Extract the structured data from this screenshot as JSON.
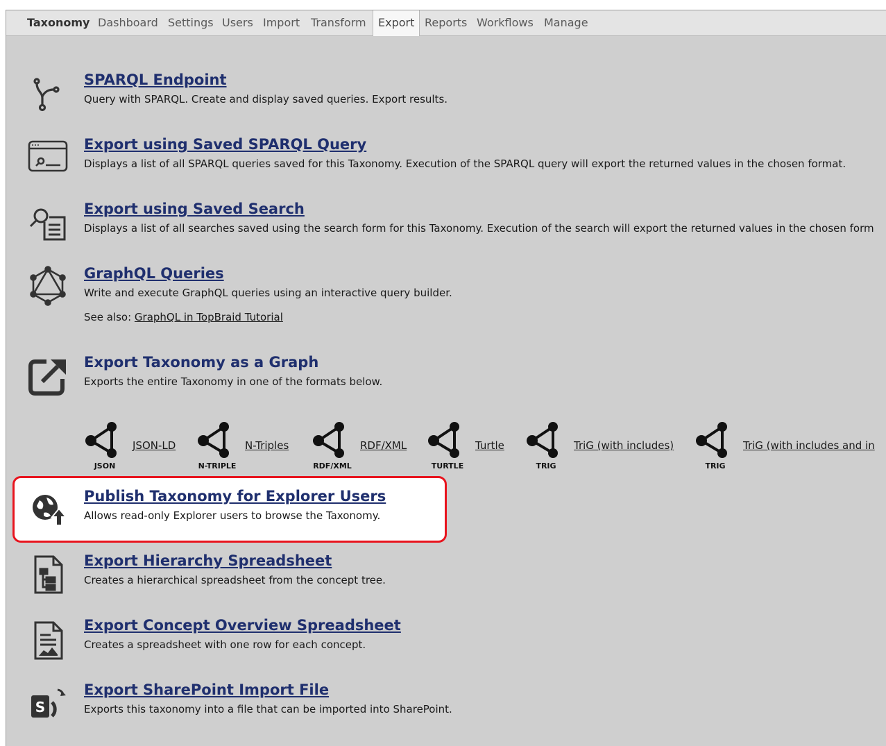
{
  "tabs": [
    "Taxonomy",
    "Dashboard",
    "Settings",
    "Users",
    "Import",
    "Transform",
    "Export",
    "Reports",
    "Workflows",
    "Manage"
  ],
  "active_tab": "Export",
  "items": [
    {
      "icon": "sparql-branch-icon",
      "title": "SPARQL Endpoint",
      "desc": "Query with SPARQL. Create and display saved queries. Export results."
    },
    {
      "icon": "saved-query-window-icon",
      "title": "Export using Saved SPARQL Query",
      "desc": "Displays a list of all SPARQL queries saved for this Taxonomy. Execution of the SPARQL query will export the returned values in the chosen format."
    },
    {
      "icon": "saved-search-icon",
      "title": "Export using Saved Search",
      "desc": "Displays a list of all searches saved using the search form for this Taxonomy. Execution of the search will export the returned values in the chosen form"
    },
    {
      "icon": "graphql-icon",
      "title": "GraphQL Queries",
      "desc": "Write and execute GraphQL queries using an interactive query builder.",
      "see_also_prefix": "See also: ",
      "see_also_link": "GraphQL in TopBraid Tutorial"
    },
    {
      "icon": "export-arrow-icon",
      "title": "Export Taxonomy as a Graph",
      "desc": "Exports the entire Taxonomy in one of the formats below."
    },
    {
      "icon": "publish-globe-icon",
      "title": "Publish Taxonomy for Explorer Users",
      "desc": "Allows read-only Explorer users to browse the Taxonomy."
    },
    {
      "icon": "hierarchy-spreadsheet-icon",
      "title": "Export Hierarchy Spreadsheet",
      "desc": "Creates a hierarchical spreadsheet from the concept tree."
    },
    {
      "icon": "overview-spreadsheet-icon",
      "title": "Export Concept Overview Spreadsheet",
      "desc": "Creates a spreadsheet with one row for each concept."
    },
    {
      "icon": "sharepoint-icon",
      "title": "Export SharePoint Import File",
      "desc": "Exports this taxonomy into a file that can be imported into SharePoint."
    }
  ],
  "formats": [
    {
      "caption": "JSON",
      "link": "JSON-LD"
    },
    {
      "caption": "N-TRIPLE",
      "link": "N-Triples"
    },
    {
      "caption": "RDF/XML",
      "link": "RDF/XML"
    },
    {
      "caption": "TURTLE",
      "link": "Turtle"
    },
    {
      "caption": "TRIG",
      "link": "TriG (with includes)"
    },
    {
      "caption": "TRIG",
      "link": "TriG (with includes and in"
    }
  ],
  "highlight_color": "#e8141e",
  "link_color": "#1f2f6e"
}
